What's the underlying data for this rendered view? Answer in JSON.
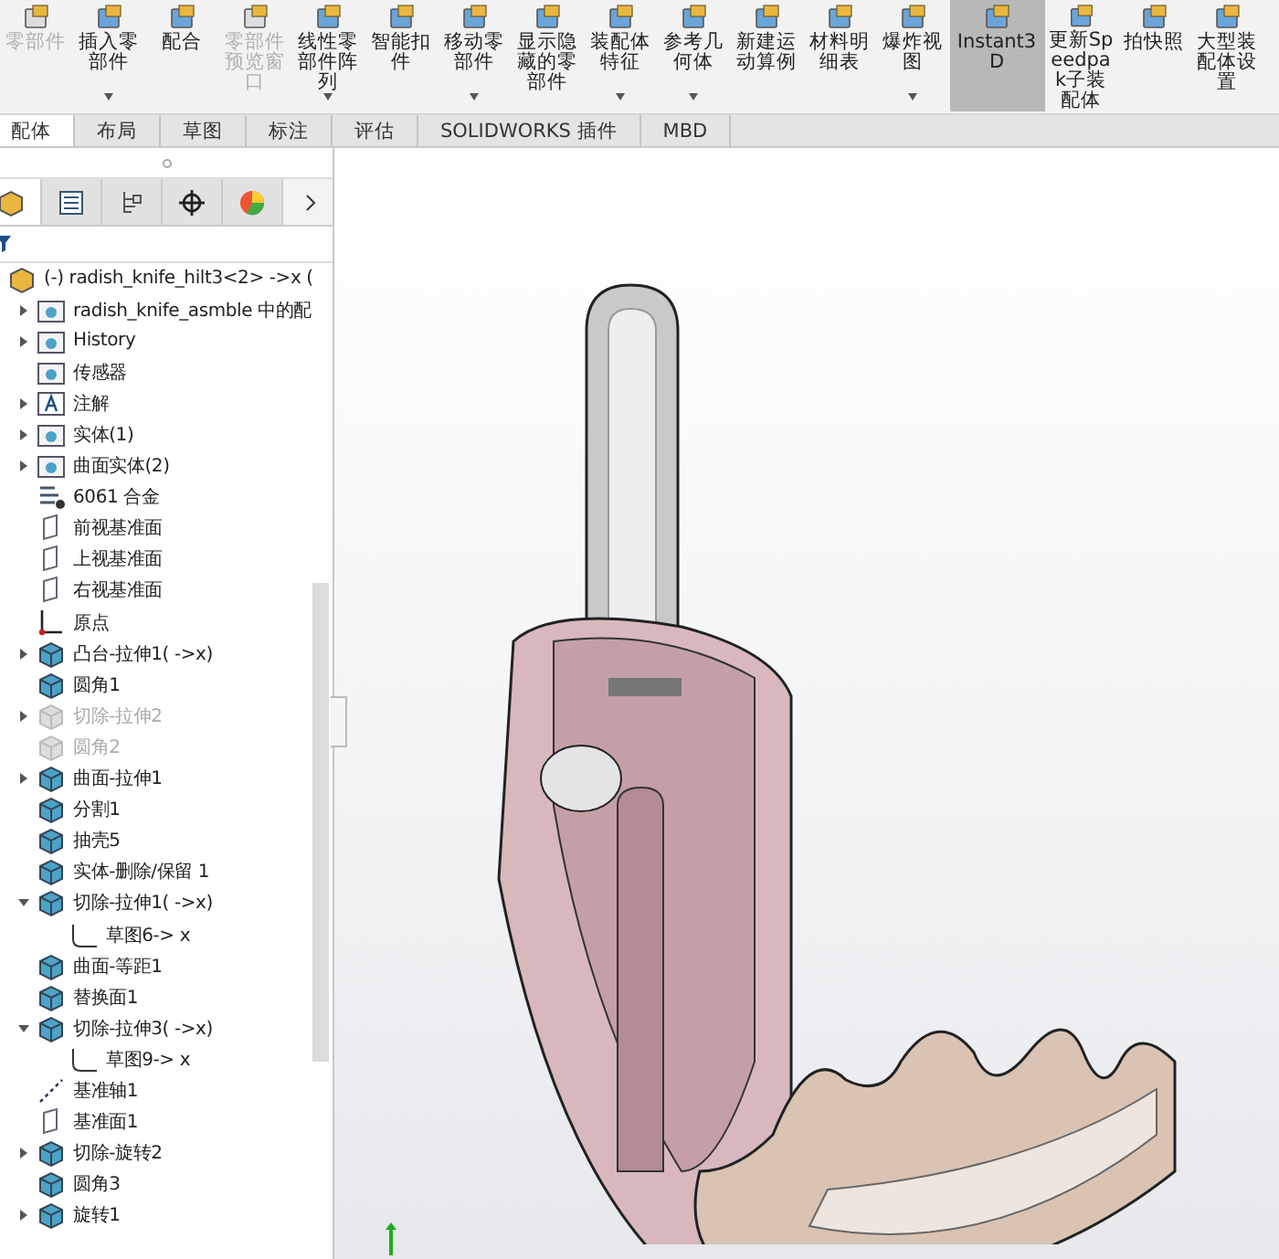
{
  "toolbar": {
    "buttons": [
      {
        "label": "零部件",
        "disabled": true,
        "dropdown": false,
        "selected": false
      },
      {
        "label": "插入零部件",
        "disabled": false,
        "dropdown": true,
        "selected": false
      },
      {
        "label": "配合",
        "disabled": false,
        "dropdown": false,
        "selected": false
      },
      {
        "label": "零部件预览窗口",
        "disabled": true,
        "dropdown": false,
        "selected": false
      },
      {
        "label": "线性零部件阵列",
        "disabled": false,
        "dropdown": true,
        "selected": false
      },
      {
        "label": "智能扣件",
        "disabled": false,
        "dropdown": false,
        "selected": false
      },
      {
        "label": "移动零部件",
        "disabled": false,
        "dropdown": true,
        "selected": false
      },
      {
        "label": "显示隐藏的零部件",
        "disabled": false,
        "dropdown": false,
        "selected": false
      },
      {
        "label": "装配体特征",
        "disabled": false,
        "dropdown": true,
        "selected": false
      },
      {
        "label": "参考几何体",
        "disabled": false,
        "dropdown": true,
        "selected": false
      },
      {
        "label": "新建运动算例",
        "disabled": false,
        "dropdown": false,
        "selected": false
      },
      {
        "label": "材料明细表",
        "disabled": false,
        "dropdown": false,
        "selected": false
      },
      {
        "label": "爆炸视图",
        "disabled": false,
        "dropdown": true,
        "selected": false
      },
      {
        "label": "Instant3D",
        "disabled": false,
        "dropdown": false,
        "selected": true
      },
      {
        "label": "更新Speedpak子装配体",
        "disabled": false,
        "dropdown": false,
        "selected": false
      },
      {
        "label": "拍快照",
        "disabled": false,
        "dropdown": false,
        "selected": false
      },
      {
        "label": "大型装配体设置",
        "disabled": false,
        "dropdown": false,
        "selected": false
      }
    ]
  },
  "tabs": [
    {
      "label": "配体",
      "selected": true
    },
    {
      "label": "布局",
      "selected": false
    },
    {
      "label": "草图",
      "selected": false
    },
    {
      "label": "标注",
      "selected": false
    },
    {
      "label": "评估",
      "selected": false
    },
    {
      "label": "SOLIDWORKS 插件",
      "selected": false
    },
    {
      "label": "MBD",
      "selected": false
    }
  ],
  "panel_tabs": [
    {
      "kind": "tree",
      "selected": true
    },
    {
      "kind": "property",
      "selected": false
    },
    {
      "kind": "config",
      "selected": false
    },
    {
      "kind": "dim",
      "selected": false
    },
    {
      "kind": "display",
      "selected": false
    }
  ],
  "feature_tree": {
    "root": "(-) radish_knife_hilt3<2> ->x (",
    "items": [
      {
        "label": "radish_knife_asmble 中的配",
        "kind": "folder",
        "expanded": false,
        "suppressed": false
      },
      {
        "label": "History",
        "kind": "folder",
        "expanded": false,
        "suppressed": false
      },
      {
        "label": "传感器",
        "kind": "folder",
        "suppressed": false
      },
      {
        "label": "注解",
        "kind": "annotation",
        "expanded": false,
        "suppressed": false
      },
      {
        "label": "实体(1)",
        "kind": "folder",
        "expanded": false,
        "suppressed": false
      },
      {
        "label": "曲面实体(2)",
        "kind": "folder",
        "expanded": false,
        "suppressed": false
      },
      {
        "label": "6061 合金",
        "kind": "material",
        "suppressed": false
      },
      {
        "label": "前视基准面",
        "kind": "plane",
        "suppressed": false
      },
      {
        "label": "上视基准面",
        "kind": "plane",
        "suppressed": false
      },
      {
        "label": "右视基准面",
        "kind": "plane",
        "suppressed": false
      },
      {
        "label": "原点",
        "kind": "origin",
        "suppressed": false
      },
      {
        "label": "凸台-拉伸1( ->x)",
        "kind": "feature",
        "expanded": false,
        "suppressed": false
      },
      {
        "label": "圆角1",
        "kind": "feature",
        "suppressed": false
      },
      {
        "label": "切除-拉伸2",
        "kind": "feature",
        "expanded": false,
        "suppressed": true
      },
      {
        "label": "圆角2",
        "kind": "feature",
        "suppressed": true
      },
      {
        "label": "曲面-拉伸1",
        "kind": "feature",
        "expanded": false,
        "suppressed": false
      },
      {
        "label": "分割1",
        "kind": "feature",
        "suppressed": false
      },
      {
        "label": "抽壳5",
        "kind": "feature",
        "suppressed": false
      },
      {
        "label": "实体-删除/保留 1",
        "kind": "feature",
        "suppressed": false
      },
      {
        "label": "切除-拉伸1( ->x)",
        "kind": "feature",
        "expanded": true,
        "suppressed": false,
        "children": [
          {
            "label": "草图6-> x",
            "kind": "sketch",
            "suppressed": false
          }
        ]
      },
      {
        "label": "曲面-等距1",
        "kind": "feature",
        "suppressed": false
      },
      {
        "label": "替换面1",
        "kind": "feature",
        "suppressed": false
      },
      {
        "label": "切除-拉伸3( ->x)",
        "kind": "feature",
        "expanded": true,
        "suppressed": false,
        "children": [
          {
            "label": "草图9-> x",
            "kind": "sketch",
            "suppressed": false
          }
        ]
      },
      {
        "label": "基准轴1",
        "kind": "axis",
        "suppressed": false
      },
      {
        "label": "基准面1",
        "kind": "plane",
        "suppressed": false
      },
      {
        "label": "切除-旋转2",
        "kind": "feature",
        "expanded": false,
        "suppressed": false
      },
      {
        "label": "圆角3",
        "kind": "feature",
        "suppressed": false
      },
      {
        "label": "旋转1",
        "kind": "feature",
        "expanded": false,
        "suppressed": false
      }
    ]
  }
}
